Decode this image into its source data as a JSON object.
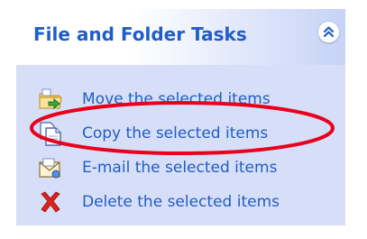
{
  "panel": {
    "title": "File and Folder Tasks",
    "collapse_icon": "chevron-up-double-icon",
    "colors": {
      "title": "#215dc6",
      "link": "#215dc6",
      "panel_bg": "#d6dff7",
      "highlight_ellipse": "#e8001c"
    }
  },
  "tasks": [
    {
      "label": "Move the selected items",
      "icon": "move-folder-icon"
    },
    {
      "label": "Copy the selected items",
      "icon": "copy-document-icon"
    },
    {
      "label": "E-mail the selected items",
      "icon": "email-envelope-icon"
    },
    {
      "label": "Delete the selected items",
      "icon": "delete-x-icon"
    }
  ],
  "annotation": {
    "highlighted_task": "Copy the selected items"
  }
}
